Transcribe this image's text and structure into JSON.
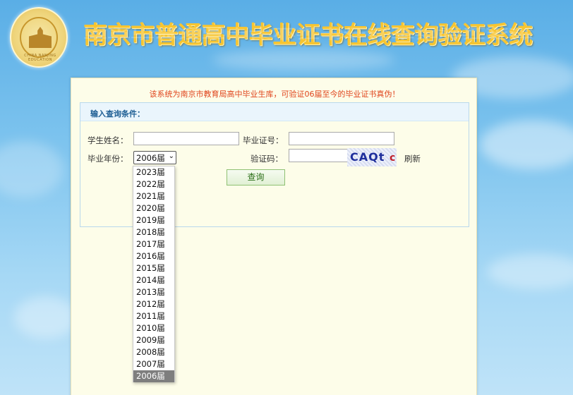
{
  "header": {
    "title": "南京市普通高中毕业证书在线查询验证系统",
    "logo_text": "CHINA NANJING EDUCATION",
    "logo_icon": "nanjing-education-emblem-icon"
  },
  "notice": "该系统为南京市教育局高中毕业生库，可验证06届至今的毕业证书真伪！",
  "form": {
    "heading": "输入查询条件：",
    "name_label": "学生姓名：",
    "name_value": "",
    "cert_label": "毕业证号：",
    "cert_value": "",
    "year_label": "毕业年份：",
    "year_selected": "2006届",
    "year_arrow": "⌄",
    "captcha_label": "验证码：",
    "captcha_value": "",
    "captcha_text": "CAQt",
    "captcha_tail": "c",
    "refresh_label": "刷新",
    "query_button": "查询"
  },
  "year_options": [
    "2023届",
    "2022届",
    "2021届",
    "2020届",
    "2019届",
    "2018届",
    "2017届",
    "2016届",
    "2015届",
    "2014届",
    "2013届",
    "2012届",
    "2011届",
    "2010届",
    "2009届",
    "2008届",
    "2007届",
    "2006届"
  ]
}
